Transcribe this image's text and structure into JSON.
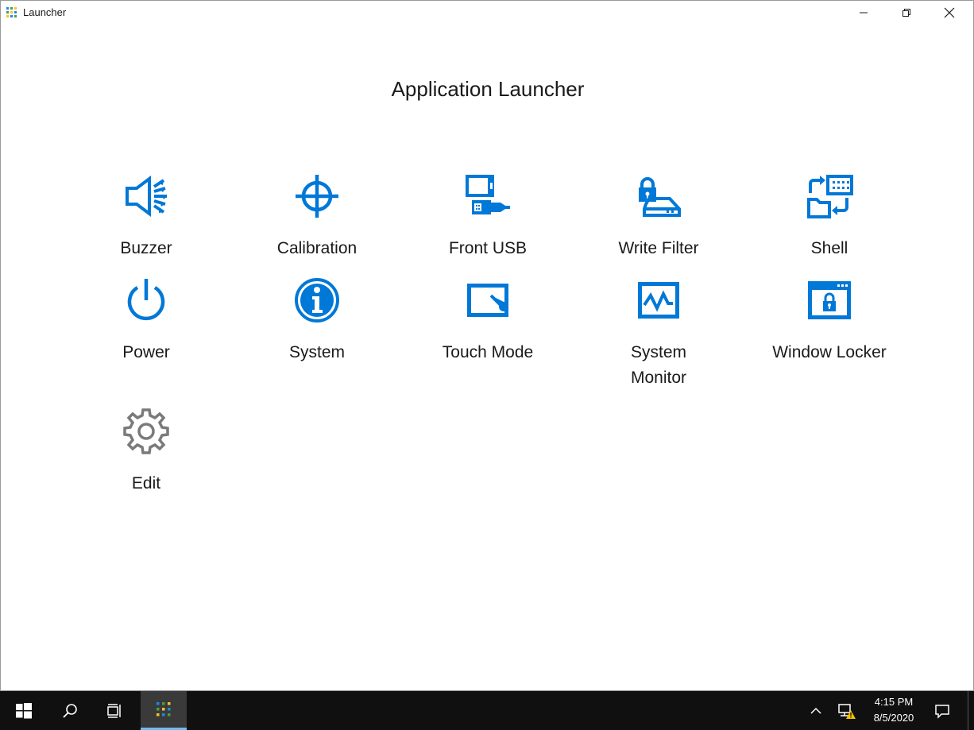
{
  "window": {
    "title": "Launcher",
    "controls": {
      "minimize_icon": "minimize-icon",
      "restore_icon": "restore-icon",
      "close_icon": "close-icon"
    }
  },
  "heading": "Application Launcher",
  "accent_color": "#0078d7",
  "edit_icon_color": "#7a7a7a",
  "apps": [
    {
      "label": "Buzzer",
      "icon": "speaker-icon"
    },
    {
      "label": "Calibration",
      "icon": "crosshair-icon"
    },
    {
      "label": "Front USB",
      "icon": "usb-icon"
    },
    {
      "label": "Write Filter",
      "icon": "locked-drive-icon"
    },
    {
      "label": "Shell",
      "icon": "shell-swap-icon"
    },
    {
      "label": "Power",
      "icon": "power-icon"
    },
    {
      "label": "System",
      "icon": "info-icon"
    },
    {
      "label": "Touch Mode",
      "icon": "touch-icon"
    },
    {
      "label": "System Monitor",
      "icon": "monitor-pulse-icon"
    },
    {
      "label": "Window Locker",
      "icon": "window-lock-icon"
    },
    {
      "label": "Edit",
      "icon": "gear-icon"
    }
  ],
  "taskbar": {
    "time": "4:15 PM",
    "date": "8/5/2020",
    "items": [
      "windows-start-icon",
      "search-icon",
      "task-view-icon",
      "launcher-icon"
    ],
    "tray": [
      "chevron-up-icon",
      "network-warning-icon",
      "action-center-icon"
    ]
  }
}
